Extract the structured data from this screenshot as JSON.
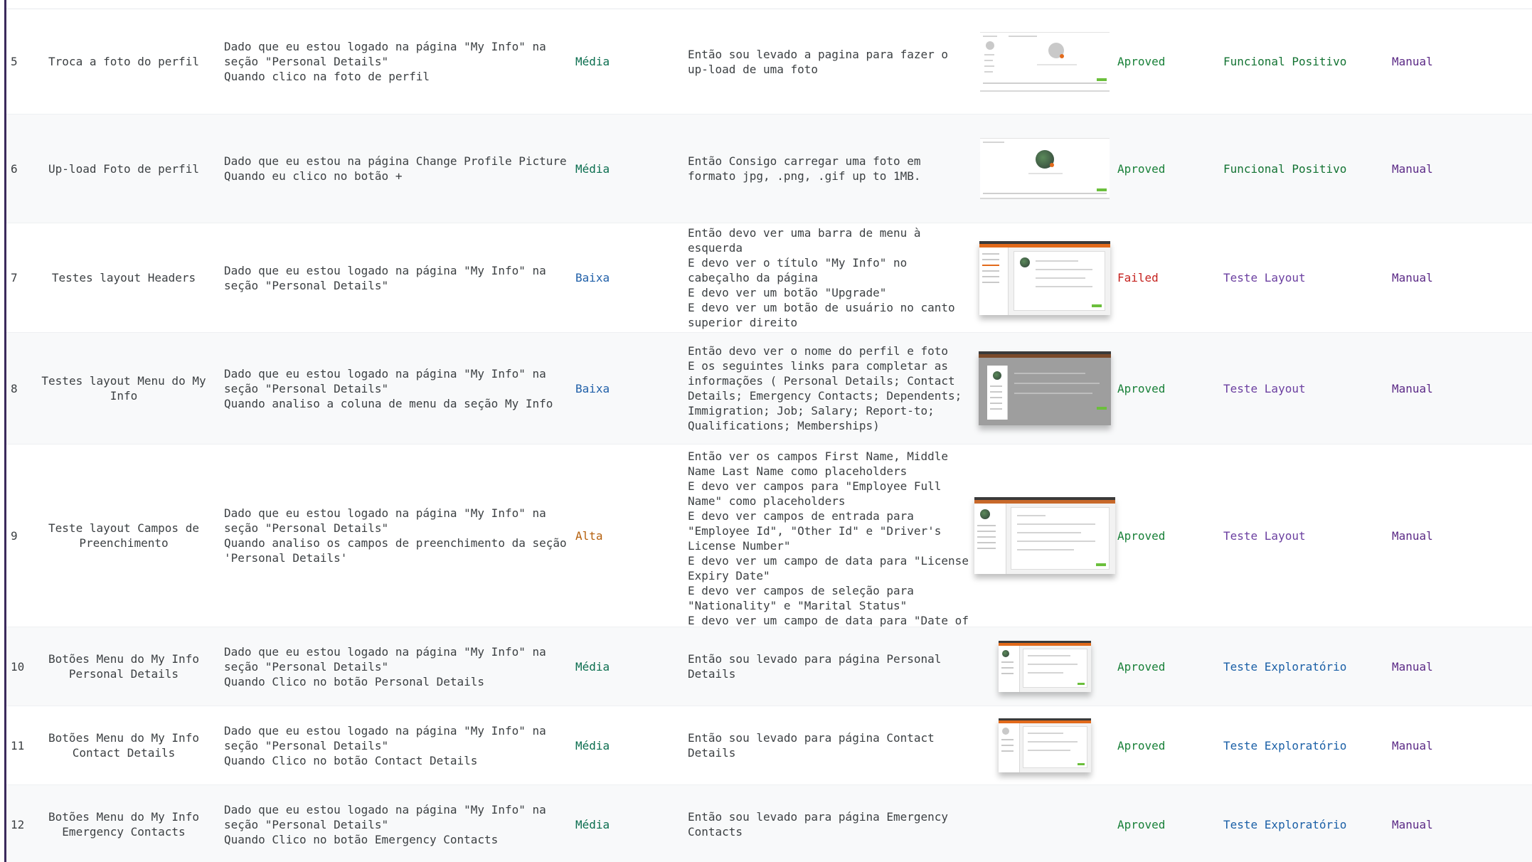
{
  "rows": [
    {
      "id": "5",
      "title": "Troca a foto do perfil",
      "given": "Dado que eu estou logado na página \"My Info\" na\nseção \"Personal Details\"\nQuando clico na foto de perfil",
      "priority": "Média",
      "expected": "Então sou levado a pagina para fazer o\nup-load de uma foto",
      "status": "Aproved",
      "test_type": "Funcional Positivo",
      "execution": "Manual"
    },
    {
      "id": "6",
      "title": "Up-load Foto de perfil",
      "given": "Dado que eu estou na página Change Profile Picture\nQuando eu clico no botão +",
      "priority": "Média",
      "expected": "Então Consigo carregar uma foto em\nformato jpg, .png, .gif up to 1MB.",
      "status": "Aproved",
      "test_type": "Funcional Positivo",
      "execution": "Manual"
    },
    {
      "id": "7",
      "title": "Testes layout Headers",
      "given": "Dado que eu estou logado na página \"My Info\" na\nseção \"Personal Details\"",
      "priority": "Baixa",
      "expected": "Então devo ver uma barra de menu à\nesquerda\nE devo ver o título \"My Info\" no\ncabeçalho da página\nE devo ver um botão \"Upgrade\"\nE devo ver um botão de usuário no canto\nsuperior direito",
      "status": "Failed",
      "test_type": "Teste Layout",
      "execution": "Manual"
    },
    {
      "id": "8",
      "title": "Testes layout Menu do My\nInfo",
      "given": "Dado que eu estou logado na página \"My Info\" na\nseção \"Personal Details\"\nQuando analiso a coluna de menu da seção My Info",
      "priority": "Baixa",
      "expected": "Então devo ver o nome do perfil e foto\nE os seguintes links para completar as\ninformações ( Personal Details;  Contact\nDetails;  Emergency Contacts; Dependents;\nImmigration; Job; Salary; Report-to;\nQualifications; Memberships)",
      "status": "Aproved",
      "test_type": "Teste Layout",
      "execution": "Manual"
    },
    {
      "id": "9",
      "title": "Teste layout Campos de\nPreenchimento",
      "given": "Dado que eu estou logado na página \"My Info\" na\nseção \"Personal Details\"\nQuando analiso os campos de preenchimento da seção\n'Personal Details'",
      "priority": "Alta",
      "expected": "Então ver os campos First Name, Middle\nName Last Name como placeholders\nE devo ver campos para \"Employee Full\nName\" como placeholders\nE devo ver campos de entrada para\n\"Employee Id\", \"Other Id\" e \"Driver's\nLicense Number\"\nE devo ver um campo de data para \"License\nExpiry Date\"\nE devo ver campos de seleção para\n\"Nationality\" e \"Marital Status\"\nE devo ver um campo de data para \"Date of\nBirth\"",
      "status": "Aproved",
      "test_type": "Teste Layout",
      "execution": "Manual"
    },
    {
      "id": "10",
      "title": "Botões Menu do My Info\nPersonal Details",
      "given": "Dado que eu estou logado na página \"My Info\" na\nseção \"Personal Details\"\nQuando Clico no botão Personal Details",
      "priority": "Média",
      "expected": "Então sou levado para página Personal\nDetails",
      "status": "Aproved",
      "test_type": "Teste Exploratório",
      "execution": "Manual"
    },
    {
      "id": "11",
      "title": "Botões Menu do My Info\nContact Details",
      "given": "Dado que eu estou logado na página \"My Info\" na\nseção \"Personal Details\"\nQuando Clico no botão Contact Details",
      "priority": "Média",
      "expected": "Então sou levado para página Contact\nDetails",
      "status": "Aproved",
      "test_type": "Teste Exploratório",
      "execution": "Manual"
    },
    {
      "id": "12",
      "title": "Botões Menu do My Info\nEmergency Contacts",
      "given": "Dado que eu estou logado na página \"My Info\" na\nseção \"Personal Details\"\nQuando Clico no botão Emergency Contacts",
      "priority": "Média",
      "expected": "Então sou levado para página Emergency\nContacts",
      "status": "Aproved",
      "test_type": "Teste Exploratório",
      "execution": "Manual"
    }
  ],
  "colors": {
    "left_rule": "#3b2a5c",
    "priority_media": "#0b6e4f",
    "priority_baixa": "#1f5fa8",
    "priority_alta": "#b5600d",
    "status_aproved": "#188038",
    "status_failed": "#c5221f",
    "type_funcional": "#137333",
    "type_layout": "#6b3fa0",
    "type_exploratorio": "#1a5fa6",
    "execution_manual": "#5b2a86"
  }
}
